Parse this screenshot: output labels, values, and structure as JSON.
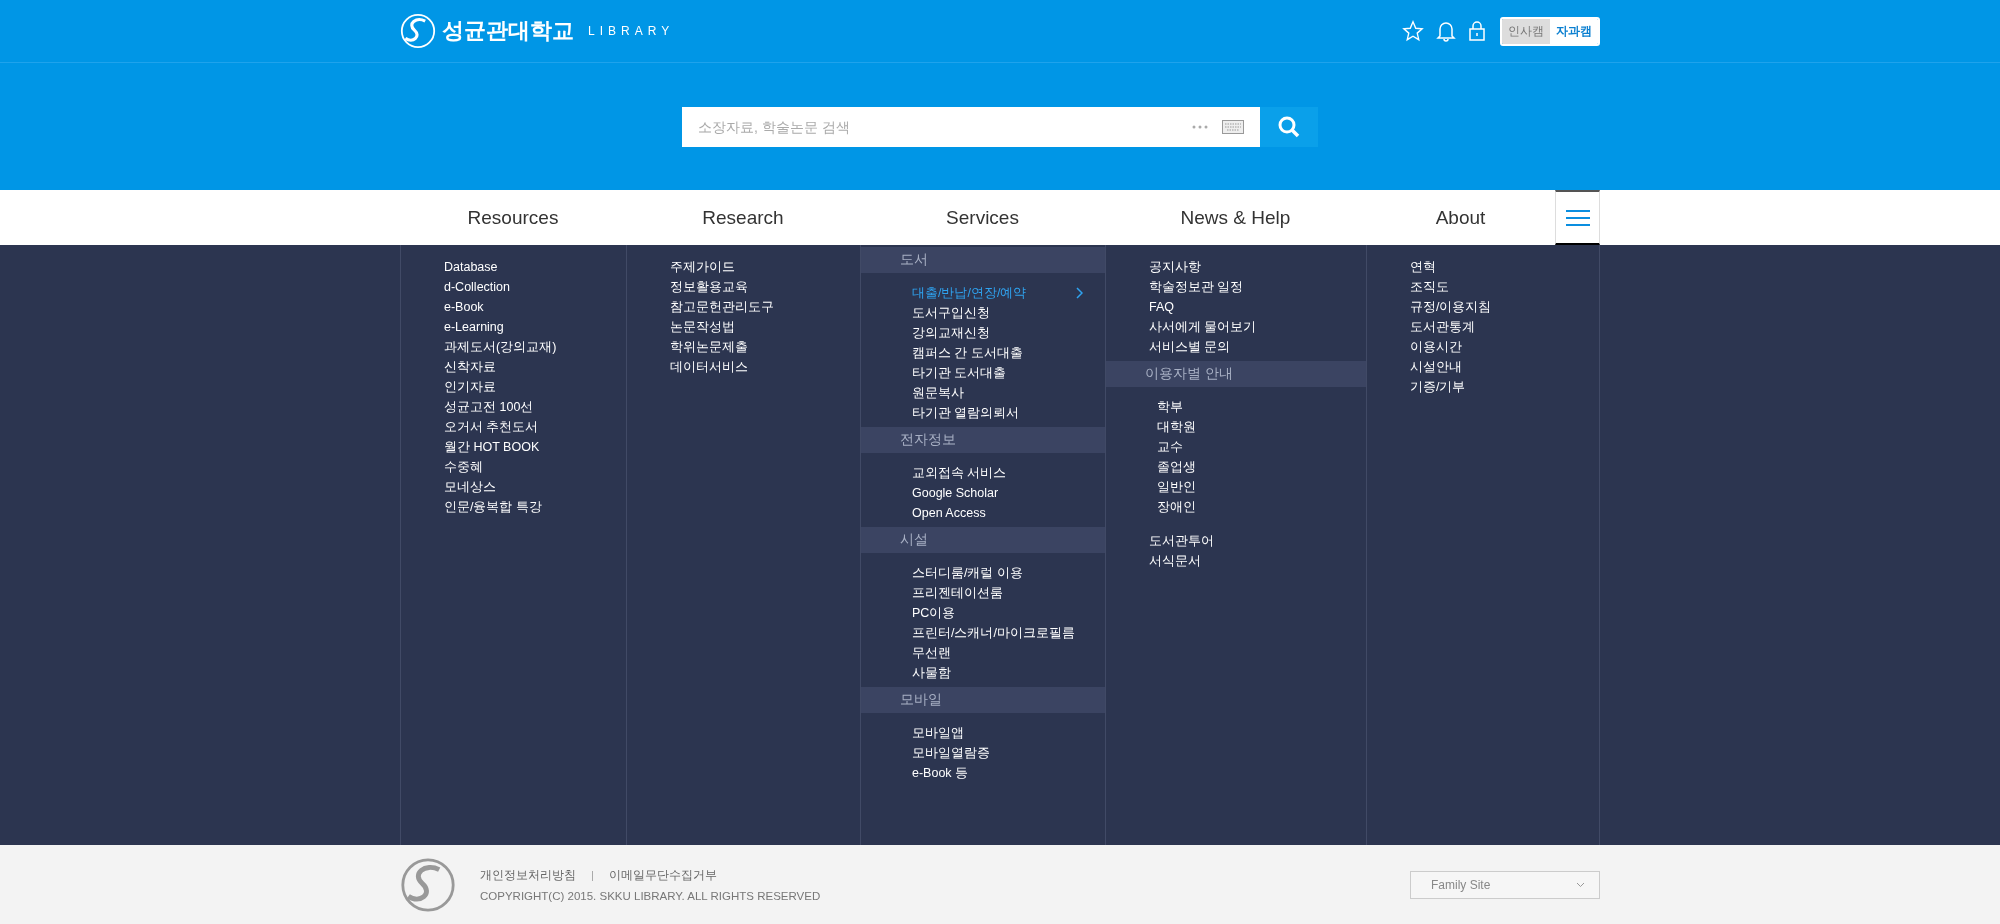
{
  "header": {
    "logo_text": "성균관대학교",
    "logo_sub": "LIBRARY",
    "campuses": [
      {
        "label": "인사캠",
        "selected": false
      },
      {
        "label": "자과캠",
        "selected": true
      }
    ]
  },
  "search": {
    "placeholder": "소장자료, 학술논문 검색"
  },
  "nav": [
    "Resources",
    "Research",
    "Services",
    "News & Help",
    "About"
  ],
  "menu_columns": [
    {
      "groups": [
        {
          "items": [
            {
              "label": "Database",
              "selected": false
            },
            {
              "label": "d-Collection",
              "selected": false
            },
            {
              "label": "e-Book",
              "selected": false
            },
            {
              "label": "e-Learning",
              "selected": false
            },
            {
              "label": "과제도서(강의교재)",
              "selected": false
            },
            {
              "label": "신착자료",
              "selected": false
            },
            {
              "label": "인기자료",
              "selected": false
            },
            {
              "label": "성균고전 100선",
              "selected": false
            },
            {
              "label": "오거서 추천도서",
              "selected": false
            },
            {
              "label": "월간 HOT BOOK",
              "selected": false
            },
            {
              "label": "수중혜",
              "selected": false
            },
            {
              "label": "모네상스",
              "selected": false
            },
            {
              "label": "인문/융복합 특강",
              "selected": false
            }
          ]
        }
      ]
    },
    {
      "groups": [
        {
          "items": [
            {
              "label": "주제가이드",
              "selected": false
            },
            {
              "label": "정보활용교육",
              "selected": false
            },
            {
              "label": "참고문헌관리도구",
              "selected": false
            },
            {
              "label": "논문작성법",
              "selected": false
            },
            {
              "label": "학위논문제출",
              "selected": false
            },
            {
              "label": "데이터서비스",
              "selected": false
            }
          ]
        }
      ]
    },
    {
      "groups": [
        {
          "heading": "도서",
          "items": [
            {
              "label": "대출/반납/연장/예약",
              "selected": true
            },
            {
              "label": "도서구입신청",
              "selected": false
            },
            {
              "label": "강의교재신청",
              "selected": false
            },
            {
              "label": "캠퍼스 간 도서대출",
              "selected": false
            },
            {
              "label": "타기관 도서대출",
              "selected": false
            },
            {
              "label": "원문복사",
              "selected": false
            },
            {
              "label": "타기관 열람의뢰서",
              "selected": false
            }
          ]
        },
        {
          "heading": "전자정보",
          "items": [
            {
              "label": "교외접속 서비스",
              "selected": false
            },
            {
              "label": "Google Scholar",
              "selected": false
            },
            {
              "label": "Open Access",
              "selected": false
            }
          ]
        },
        {
          "heading": "시설",
          "items": [
            {
              "label": "스터디룸/캐럴 이용",
              "selected": false
            },
            {
              "label": "프리젠테이션룸",
              "selected": false
            },
            {
              "label": "PC이용",
              "selected": false
            },
            {
              "label": "프린터/스캐너/마이크로필름",
              "selected": false
            },
            {
              "label": "무선랜",
              "selected": false
            },
            {
              "label": "사물함",
              "selected": false
            }
          ]
        },
        {
          "heading": "모바일",
          "items": [
            {
              "label": "모바일앱",
              "selected": false
            },
            {
              "label": "모바일열람증",
              "selected": false
            },
            {
              "label": "e-Book 등",
              "selected": false
            }
          ]
        }
      ]
    },
    {
      "groups": [
        {
          "items": [
            {
              "label": "공지사항",
              "selected": false
            },
            {
              "label": "학술정보관 일정",
              "selected": false
            },
            {
              "label": "FAQ",
              "selected": false
            },
            {
              "label": "사서에게 물어보기",
              "selected": false
            },
            {
              "label": "서비스별 문의",
              "selected": false
            }
          ]
        },
        {
          "heading": "이용자별 안내",
          "items": [
            {
              "label": "학부",
              "selected": false
            },
            {
              "label": "대학원",
              "selected": false
            },
            {
              "label": "교수",
              "selected": false
            },
            {
              "label": "졸업생",
              "selected": false
            },
            {
              "label": "일반인",
              "selected": false
            },
            {
              "label": "장애인",
              "selected": false
            }
          ]
        },
        {
          "items": [
            {
              "label": "도서관투어",
              "selected": false
            },
            {
              "label": "서식문서",
              "selected": false
            }
          ]
        }
      ]
    },
    {
      "groups": [
        {
          "items": [
            {
              "label": "연혁",
              "selected": false
            },
            {
              "label": "조직도",
              "selected": false
            },
            {
              "label": "규정/이용지침",
              "selected": false
            },
            {
              "label": "도서관통계",
              "selected": false
            },
            {
              "label": "이용시간",
              "selected": false
            },
            {
              "label": "시설안내",
              "selected": false
            },
            {
              "label": "기증/기부",
              "selected": false
            }
          ]
        }
      ]
    }
  ],
  "footer": {
    "links": [
      "개인정보처리방침",
      "이메일무단수집거부"
    ],
    "copyright": "COPYRIGHT(C) 2015.  SKKU LIBRARY.  ALL RIGHTS RESERVED",
    "family_site": "Family Site"
  }
}
